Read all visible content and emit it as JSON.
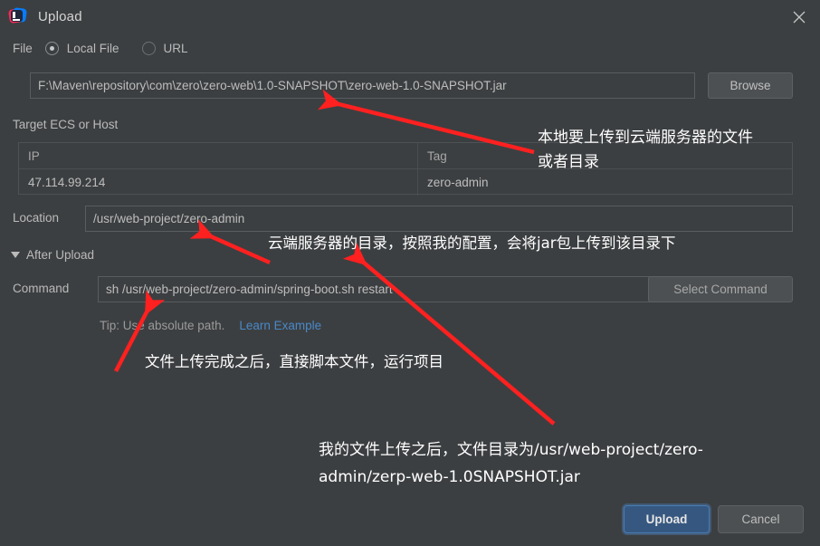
{
  "window": {
    "title": "Upload",
    "app_icon": "intellij-idea-icon",
    "close_icon": "close-icon"
  },
  "file_section": {
    "label": "File",
    "options": [
      {
        "label": "Local File",
        "selected": true
      },
      {
        "label": "URL",
        "selected": false
      }
    ],
    "path_value": "F:\\Maven\\repository\\com\\zero\\zero-web\\1.0-SNAPSHOT\\zero-web-1.0-SNAPSHOT.jar",
    "path_placeholder": "",
    "browse_label": "Browse"
  },
  "target": {
    "label": "Target ECS or Host",
    "columns": [
      "IP",
      "Tag"
    ],
    "rows": [
      {
        "ip": "47.114.99.214",
        "tag": "zero-admin"
      }
    ]
  },
  "location": {
    "label": "Location",
    "value": "/usr/web-project/zero-admin",
    "placeholder": ""
  },
  "after_upload": {
    "label": "After Upload",
    "expanded": true,
    "toggle_icon": "chevron-down-icon",
    "command_label": "Command",
    "command_value": "sh /usr/web-project/zero-admin/spring-boot.sh restart",
    "command_placeholder": "",
    "select_command_label": "Select Command",
    "tip_text": "Tip: Use absolute path.",
    "tip_link": "Learn Example"
  },
  "footer": {
    "upload_label": "Upload",
    "cancel_label": "Cancel"
  },
  "annotations": {
    "color": "#ff2020",
    "items": [
      {
        "text": "本地要上传到云端服务器的文件\n或者目录"
      },
      {
        "text": "云端服务器的目录，按照我的配置，会将jar包上传到该目录下"
      },
      {
        "text": "文件上传完成之后，直接脚本文件，运行项目"
      },
      {
        "text": "我的文件上传之后，文件目录为/usr/web-project/zero-admin/zerp-web-1.0SNAPSHOT.jar"
      }
    ]
  },
  "colors": {
    "dialog_bg": "#3c3f41",
    "input_border": "#5a5d5f",
    "text": "#bbbbbb",
    "link": "#4a88c7",
    "primary_button": "#365880",
    "annotation_red": "#ff2020"
  }
}
